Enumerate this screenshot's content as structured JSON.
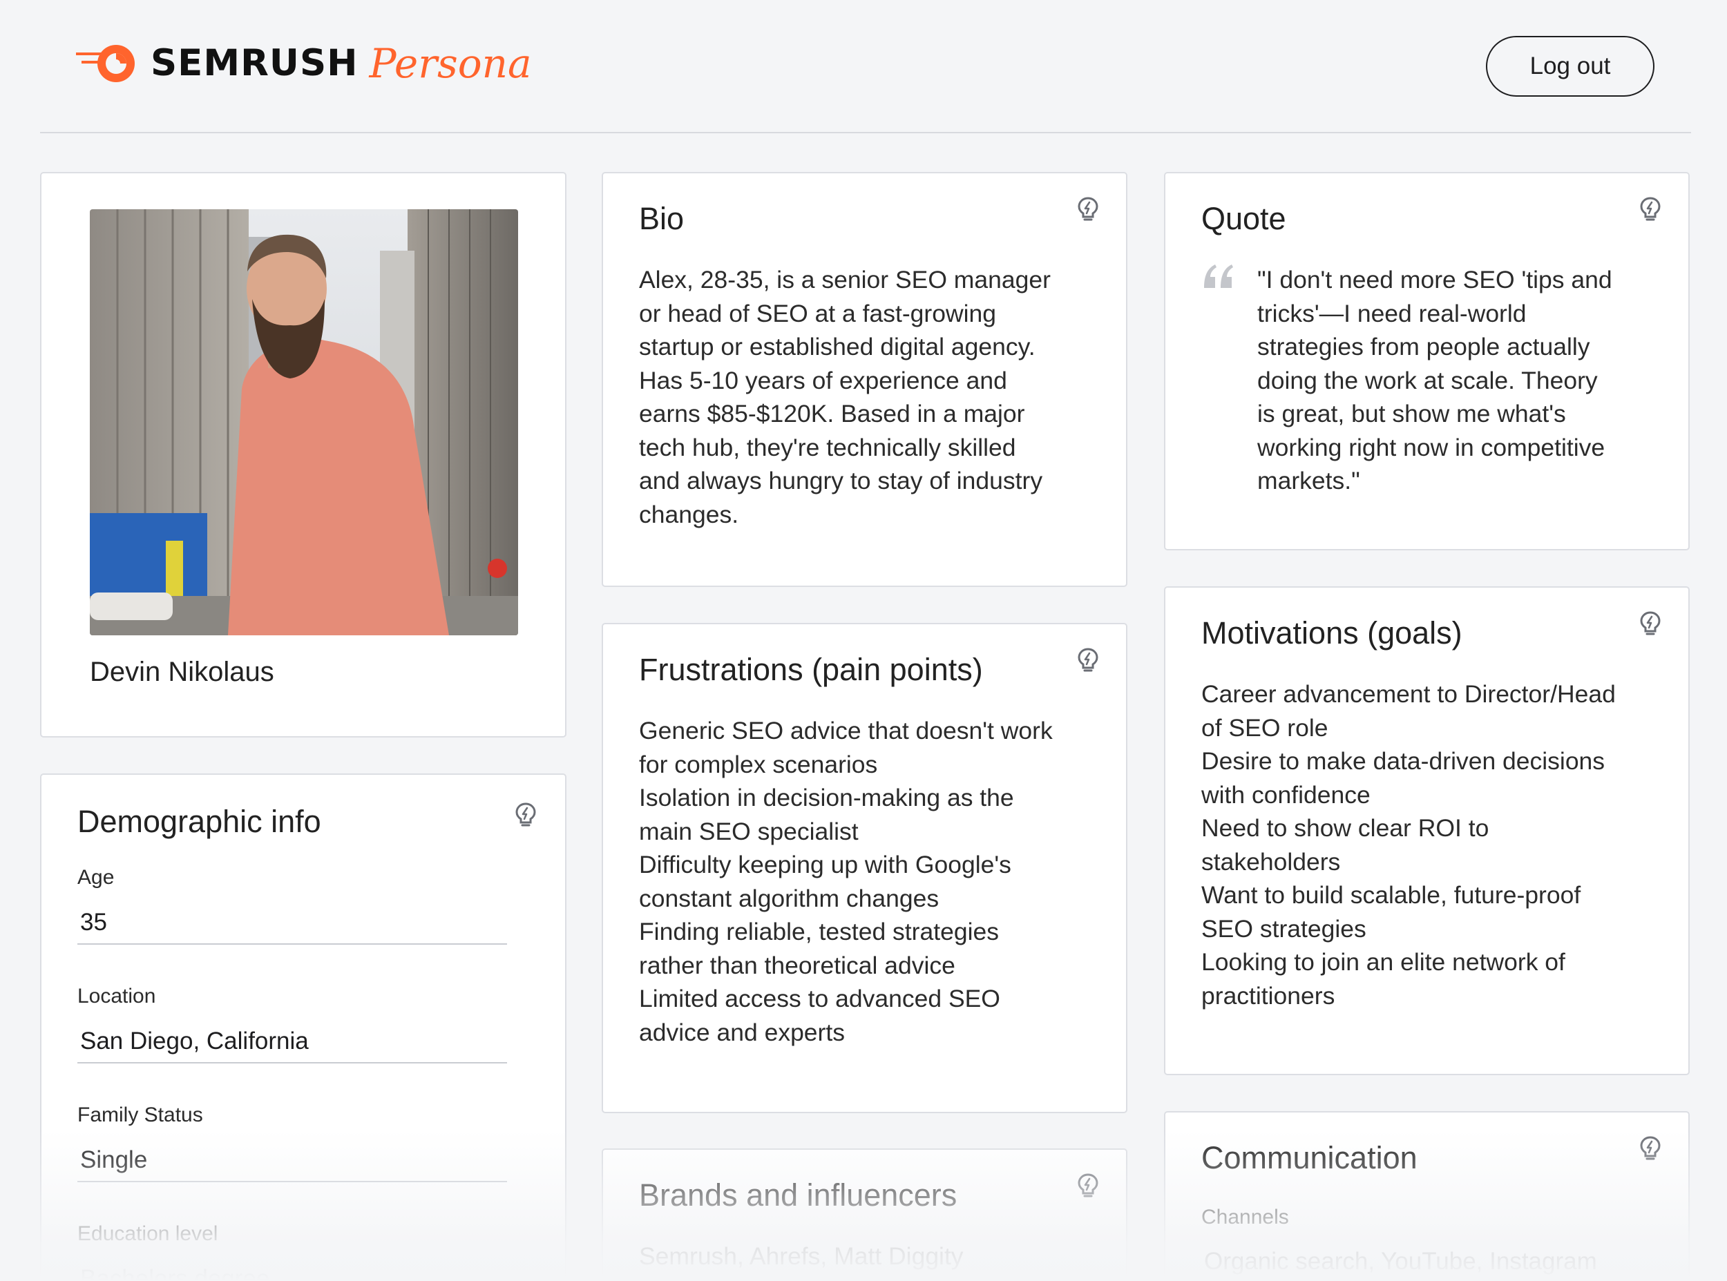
{
  "header": {
    "brand_word": "SEMRUSH",
    "brand_product": "Persona",
    "logout_label": "Log out"
  },
  "colors": {
    "brand_orange": "#ff642d",
    "card_bg": "#ffffff",
    "page_bg": "#f4f5f7"
  },
  "profile": {
    "name": "Devin Nikolaus"
  },
  "demographic": {
    "title": "Demographic info",
    "fields": [
      {
        "label": "Age",
        "value": "35"
      },
      {
        "label": "Location",
        "value": "San Diego, California"
      },
      {
        "label": "Family Status",
        "value": "Single"
      },
      {
        "label": "Education level",
        "value": "Bachelors degree"
      }
    ]
  },
  "bio": {
    "title": "Bio",
    "lines": [
      "Alex, 28-35, is a senior SEO manager",
      "or head of SEO at a fast-growing",
      "startup or established digital agency.",
      "Has 5-10 years of experience and",
      "earns $85-$120K. Based in a major",
      "tech hub, they're technically skilled",
      "and always hungry to stay of industry",
      "changes."
    ]
  },
  "quote": {
    "title": "Quote",
    "lines": [
      "\"I don't need more SEO 'tips and",
      "tricks'—I need real-world",
      "strategies from people actually",
      "doing the work at scale. Theory",
      "is great, but show me what's",
      "working right now in competitive",
      "markets.\""
    ]
  },
  "frustrations": {
    "title": "Frustrations (pain points)",
    "lines": [
      "Generic SEO advice that doesn't work",
      "for complex scenarios",
      "Isolation in decision-making as the",
      "main SEO specialist",
      "Difficulty keeping up with Google's",
      "constant algorithm changes",
      "Finding reliable, tested strategies",
      "rather than theoretical advice",
      "Limited access to advanced SEO",
      "advice and experts"
    ]
  },
  "motivations": {
    "title": "Motivations (goals)",
    "lines": [
      "Career advancement to Director/Head",
      "of SEO role",
      "Desire to make data-driven decisions",
      "with confidence",
      "Need to show clear ROI to",
      "stakeholders",
      "Want to build scalable, future-proof",
      "SEO strategies",
      "Looking to join an elite network of",
      "practitioners"
    ]
  },
  "brands": {
    "title": "Brands and influencers",
    "value": "Semrush, Ahrefs, Matt Diggity"
  },
  "communication": {
    "title": "Communication",
    "channels_label": "Channels",
    "channels_value": "Organic search, YouTube, Instagram"
  },
  "icons": {
    "hint": "lightbulb-icon",
    "logo": "semrush-flame-icon",
    "quote": "quote-mark-icon"
  }
}
